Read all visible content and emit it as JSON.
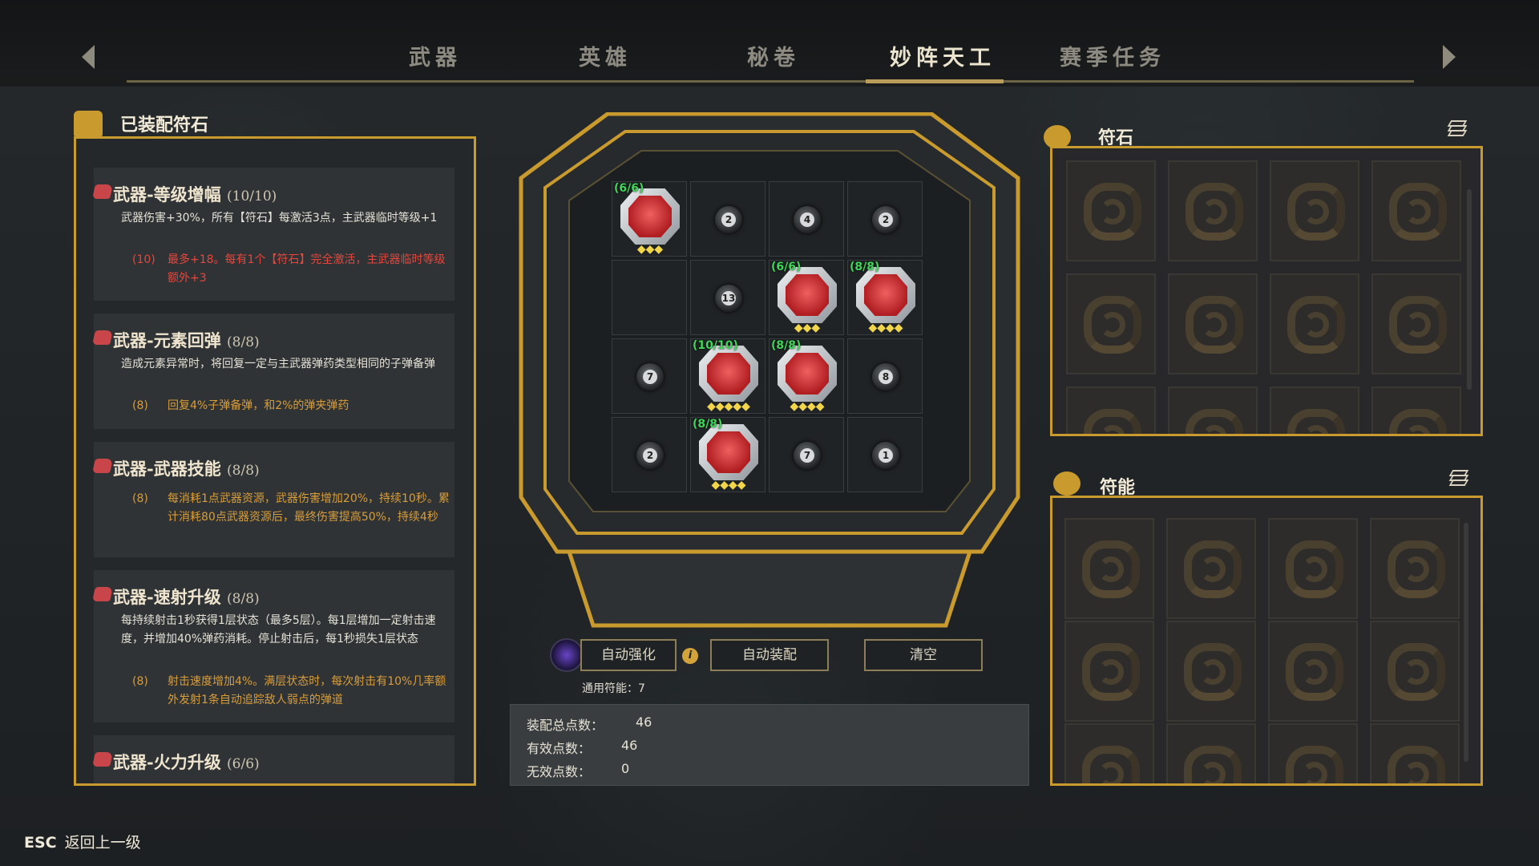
{
  "nav": {
    "tabs": [
      {
        "label": "武器"
      },
      {
        "label": "英雄"
      },
      {
        "label": "秘卷"
      },
      {
        "label": "妙阵天工",
        "active": true
      },
      {
        "label": "赛季任务"
      }
    ]
  },
  "equipped": {
    "title": "已装配符石",
    "cards": [
      {
        "name": "武器-等级增幅",
        "count": "(10/10)",
        "desc": "武器伤害+30%，所有【符石】每激活3点，主武器临时等级+1",
        "bonus_level": "(10)",
        "bonus_text": "最多+18。每有1个【符石】完全激活，主武器临时等级额外+3",
        "bonus_color": "red"
      },
      {
        "name": "武器-元素回弹",
        "count": "(8/8)",
        "desc": "造成元素异常时，将回复一定与主武器弹药类型相同的子弹备弹",
        "bonus_level": "(8)",
        "bonus_text": "回复4%子弹备弹，和2%的弹夹弹药",
        "bonus_color": "orange"
      },
      {
        "name": "武器-武器技能",
        "count": "(8/8)",
        "desc": "",
        "bonus_level": "(8)",
        "bonus_text": "每消耗1点武器资源，武器伤害增加20%，持续10秒。累计消耗80点武器资源后，最终伤害提高50%，持续4秒",
        "bonus_color": "orange"
      },
      {
        "name": "武器-速射升级",
        "count": "(8/8)",
        "desc": "每持续射击1秒获得1层状态（最多5层）。每1层增加一定射击速度，并增加40%弹药消耗。停止射击后，每1秒损失1层状态",
        "bonus_level": "(8)",
        "bonus_text": "射击速度增加4%。满层状态时，每次射击有10%几率额外发射1条自动追踪敌人弱点的弹道",
        "bonus_color": "orange"
      },
      {
        "name": "武器-火力升级",
        "count": "(6/6)"
      }
    ]
  },
  "board": {
    "cells": [
      {
        "type": "rune",
        "label": "(6/6)",
        "stars": "◆◆◆"
      },
      {
        "type": "orb",
        "num": "2"
      },
      {
        "type": "orb",
        "num": "4"
      },
      {
        "type": "orb",
        "num": "2"
      },
      {
        "type": "empty"
      },
      {
        "type": "orb",
        "num": "13"
      },
      {
        "type": "rune",
        "label": "(6/6)",
        "stars": "◆◆◆"
      },
      {
        "type": "rune",
        "label": "(8/8)",
        "stars": "◆◆◆◆"
      },
      {
        "type": "orb",
        "num": "7"
      },
      {
        "type": "rune",
        "label": "(10/10)",
        "stars": "◆◆◆◆◆"
      },
      {
        "type": "rune",
        "label": "(8/8)",
        "stars": "◆◆◆◆"
      },
      {
        "type": "orb",
        "num": "8"
      },
      {
        "type": "orb",
        "num": "2"
      },
      {
        "type": "rune",
        "label": "(8/8)",
        "stars": "◆◆◆◆"
      },
      {
        "type": "orb",
        "num": "7"
      },
      {
        "type": "orb",
        "num": "1"
      }
    ]
  },
  "actions": {
    "auto_enhance": "自动强化",
    "auto_equip": "自动装配",
    "clear": "清空",
    "universal_energy": "通用符能：7"
  },
  "stats": {
    "total_label": "装配总点数：",
    "total_value": "46",
    "valid_label": "有效点数：",
    "valid_value": "46",
    "invalid_label": "无效点数：",
    "invalid_value": "0"
  },
  "runestones": {
    "title": "符石"
  },
  "energy": {
    "title": "符能"
  },
  "footer": {
    "esc_key": "ESC",
    "esc_label": "返回上一级"
  },
  "colors": {
    "gold": "#c99a2d",
    "rune_red": "#c8464a",
    "bonus_red": "#e6463c",
    "bonus_orange": "#d99d3a",
    "level_green": "#3fd65a"
  }
}
